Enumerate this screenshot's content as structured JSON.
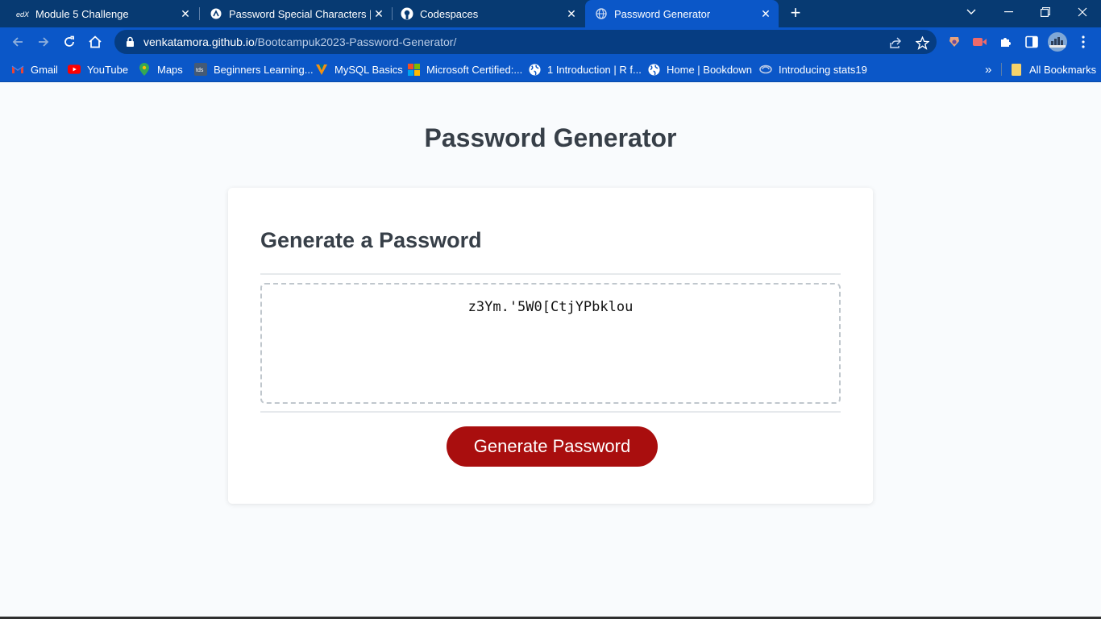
{
  "browser": {
    "tabs": [
      {
        "label": "Module 5 Challenge",
        "icon": "edx-icon",
        "active": false
      },
      {
        "label": "Password Special Characters | O\\",
        "icon": "owasp-icon",
        "active": false
      },
      {
        "label": "Codespaces",
        "icon": "github-icon",
        "active": false
      },
      {
        "label": "Password Generator",
        "icon": "globe-icon",
        "active": true
      }
    ],
    "new_tab_glyph": "+",
    "address": {
      "domain": "venkatamora.github.io",
      "path": "/Bootcampuk2023-Password-Generator/"
    },
    "bookmarks": [
      {
        "label": "Gmail",
        "icon": "gmail-icon"
      },
      {
        "label": "YouTube",
        "icon": "youtube-icon"
      },
      {
        "label": "Maps",
        "icon": "maps-icon"
      },
      {
        "label": "Beginners Learning...",
        "icon": "tds-icon"
      },
      {
        "label": "MySQL Basics",
        "icon": "mysql-icon"
      },
      {
        "label": "Microsoft Certified:...",
        "icon": "microsoft-icon"
      },
      {
        "label": "1 Introduction | R f...",
        "icon": "globe-icon"
      },
      {
        "label": "Home | Bookdown",
        "icon": "globe-icon"
      },
      {
        "label": "Introducing stats19",
        "icon": "stats-icon"
      }
    ],
    "all_bookmarks": "All Bookmarks",
    "overflow_glyph": "»"
  },
  "page": {
    "title": "Password Generator",
    "card_header": "Generate a Password",
    "password_value": "z3Ym.'5W0[CtjYPbklou",
    "generate_button": "Generate Password"
  },
  "colors": {
    "tab_strip": "#073a72",
    "toolbar": "#0b57c8",
    "button_bg": "#a90e0e",
    "heading": "#373f48"
  }
}
